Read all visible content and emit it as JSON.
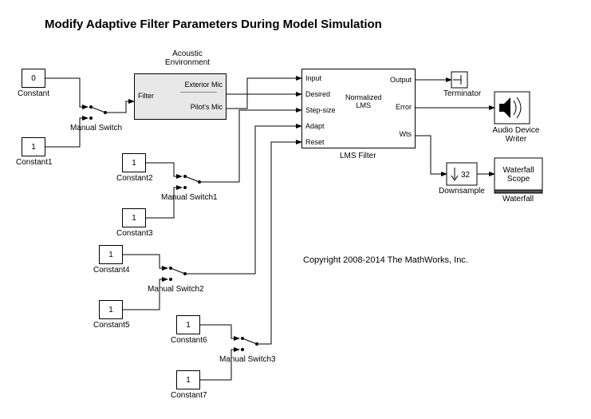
{
  "title": "Modify Adaptive Filter Parameters During Model Simulation",
  "copyright": "Copyright 2008-2014 The MathWorks, Inc.",
  "constants": {
    "c0": {
      "value": "0",
      "label": "Constant"
    },
    "c1": {
      "value": "1",
      "label": "Constant1"
    },
    "c2": {
      "value": "1",
      "label": "Constant2"
    },
    "c3": {
      "value": "1",
      "label": "Constant3"
    },
    "c4": {
      "value": "1",
      "label": "Constant4"
    },
    "c5": {
      "value": "1",
      "label": "Constant5"
    },
    "c6": {
      "value": "1",
      "label": "Constant6"
    },
    "c7": {
      "value": "1",
      "label": "Constant7"
    }
  },
  "switches": {
    "ms": {
      "label": "Manual Switch"
    },
    "ms1": {
      "label": "Manual Switch1"
    },
    "ms2": {
      "label": "Manual Switch2"
    },
    "ms3": {
      "label": "Manual Switch3"
    }
  },
  "acoustic": {
    "title": "Acoustic\nEnvironment",
    "filter_port": "Filter",
    "out1": "Exterior Mic",
    "out2": "Pilot's Mic"
  },
  "lms": {
    "label": "LMS Filter",
    "ports_in": {
      "input": "Input",
      "desired": "Desired",
      "stepsize": "Step-size",
      "adapt": "Adapt",
      "reset": "Reset"
    },
    "ports_out": {
      "output": "Output",
      "error": "Error",
      "wts": "Wts"
    },
    "center": "Normalized\nLMS"
  },
  "terminator": {
    "label": "Terminator"
  },
  "audio": {
    "label": "Audio Device\nWriter"
  },
  "downsample": {
    "label": "Downsample",
    "factor": "32"
  },
  "waterfall": {
    "block": "Waterfall\nScope",
    "label": "Waterfall"
  }
}
